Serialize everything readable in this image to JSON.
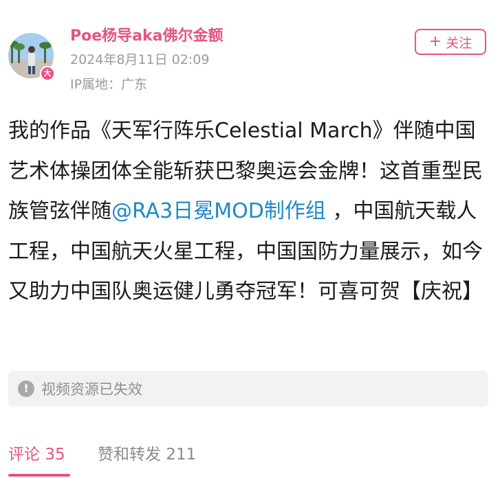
{
  "author": {
    "name": "Poe杨导aka佛尔金额",
    "timestamp": "2024年8月11日 02:09",
    "ip_location": "IP属地：广东",
    "badge": "大"
  },
  "follow_button": {
    "icon": "plus-icon",
    "label": "关注"
  },
  "post": {
    "text_before_mention": "我的作品《天军行阵乐Celestial March》伴随中国艺术体操团体全能斩获巴黎奥运会金牌！这首重型民族管弦伴随",
    "mention": "@RA3日冕MOD制作组",
    "text_after_mention": " ，中国航天载人工程，中国航天火星工程，中国国防力量展示，如今又助力中国队奥运健儿勇夺冠军！可喜可贺【庆祝】"
  },
  "video_notice": {
    "icon": "info-icon",
    "text": "视频资源已失效"
  },
  "tabs": [
    {
      "label": "评论 35",
      "active": true
    },
    {
      "label": "赞和转发 211",
      "active": false
    }
  ],
  "colors": {
    "accent": "#e4557e",
    "link": "#1e88c8",
    "muted": "#9a9a9a"
  }
}
